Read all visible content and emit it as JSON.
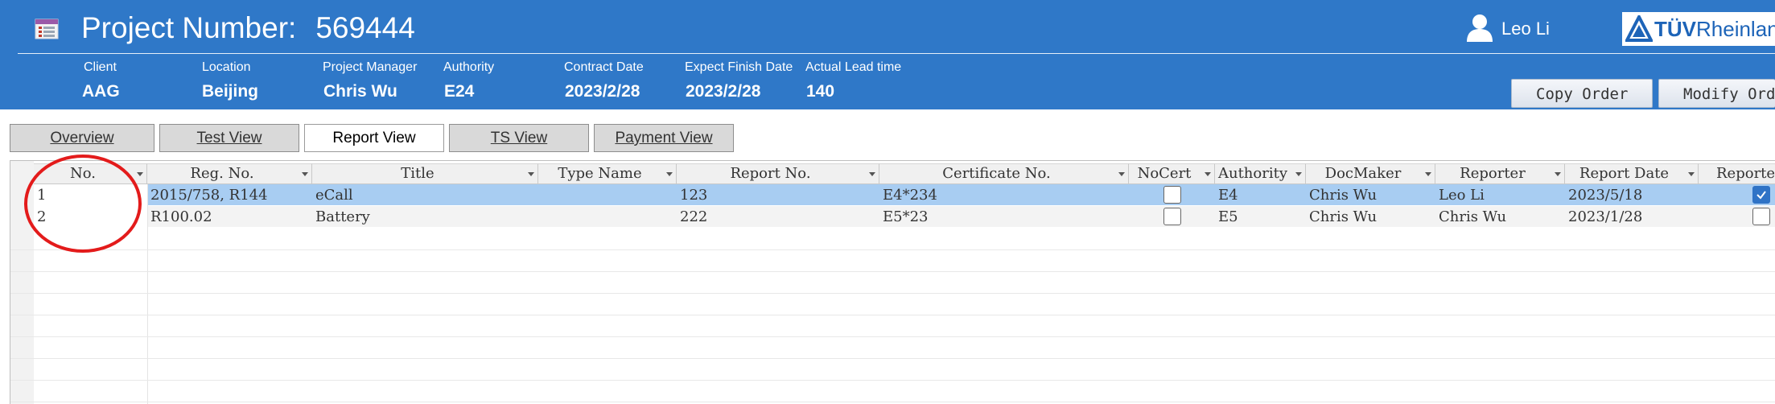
{
  "header": {
    "project_label": "Project Number:",
    "project_number": "569444",
    "user_name": "Leo Li",
    "logo_text_bold": "TÜV",
    "logo_text_rest": "Rheinland",
    "bg_color": "#2f78c8"
  },
  "info": {
    "client_label": "Client",
    "client_value": "AAG",
    "location_label": "Location",
    "location_value": "Beijing",
    "pm_label": "Project Manager",
    "pm_value": "Chris Wu",
    "authority_label": "Authority",
    "authority_value": "E24",
    "contract_label": "Contract Date",
    "contract_value": "2023/2/28",
    "finish_label": "Expect Finish Date",
    "finish_value": "2023/2/28",
    "lead_label": "Actual Lead time",
    "lead_value": "140"
  },
  "buttons": {
    "copy_order": "Copy Order",
    "modify_order": "Modify Order"
  },
  "tabs": [
    {
      "label": "Overview",
      "active": false
    },
    {
      "label": "Test View",
      "active": false
    },
    {
      "label": "Report View",
      "active": true
    },
    {
      "label": "TS View",
      "active": false
    },
    {
      "label": "Payment View",
      "active": false
    }
  ],
  "table": {
    "columns": [
      "No.",
      "Reg. No.",
      "Title",
      "Type Name",
      "Report No.",
      "Certificate No.",
      "NoCert",
      "Authority",
      "DocMaker",
      "Reporter",
      "Report Date",
      "Reported"
    ],
    "rows": [
      {
        "no": "1",
        "reg_no": "2015/758, R144",
        "title": "eCall",
        "type_name": "",
        "report_no": "123",
        "certificate_no": "E4*234",
        "no_cert": false,
        "authority": "E4",
        "doc_maker": "Chris Wu",
        "reporter": "Leo Li",
        "report_date": "2023/5/18",
        "reported": true,
        "selected": true
      },
      {
        "no": "2",
        "reg_no": "R100.02",
        "title": "Battery",
        "type_name": "",
        "report_no": "222",
        "certificate_no": "E5*23",
        "no_cert": false,
        "authority": "E5",
        "doc_maker": "Chris Wu",
        "reporter": "Chris Wu",
        "report_date": "2023/1/28",
        "reported": false,
        "selected": false
      }
    ],
    "selected_row_color": "#a8cdf2"
  },
  "annotation": {
    "shape": "red-circle",
    "target": "No. column",
    "color": "#e31b1b"
  }
}
